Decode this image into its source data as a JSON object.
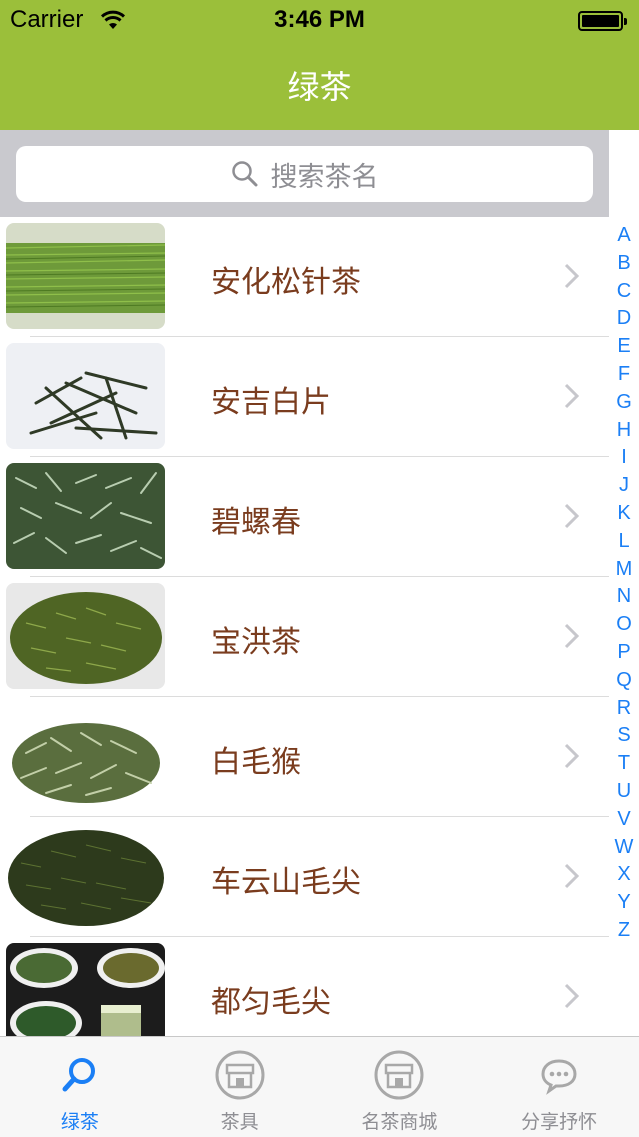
{
  "status_bar": {
    "carrier": "Carrier",
    "time": "3:46 PM"
  },
  "nav": {
    "title": "绿茶"
  },
  "search": {
    "placeholder": "搜索茶名"
  },
  "teas": [
    {
      "name": "安化松针茶"
    },
    {
      "name": "安吉白片"
    },
    {
      "name": "碧螺春"
    },
    {
      "name": "宝洪茶"
    },
    {
      "name": "白毛猴"
    },
    {
      "name": "车云山毛尖"
    },
    {
      "name": "都匀毛尖"
    }
  ],
  "index_letters": [
    "A",
    "B",
    "C",
    "D",
    "E",
    "F",
    "G",
    "H",
    "I",
    "J",
    "K",
    "L",
    "M",
    "N",
    "O",
    "P",
    "Q",
    "R",
    "S",
    "T",
    "U",
    "V",
    "W",
    "X",
    "Y",
    "Z"
  ],
  "tabs": [
    {
      "label": "绿茶",
      "icon": "search-icon",
      "active": true
    },
    {
      "label": "茶具",
      "icon": "store-icon",
      "active": false
    },
    {
      "label": "名茶商城",
      "icon": "store-icon",
      "active": false
    },
    {
      "label": "分享抒怀",
      "icon": "chat-bubble-icon",
      "active": false
    }
  ],
  "colors": {
    "nav_green": "#9bbf3a",
    "tint_blue": "#1b7ff5",
    "tea_name_brown": "#7a3c1e"
  }
}
